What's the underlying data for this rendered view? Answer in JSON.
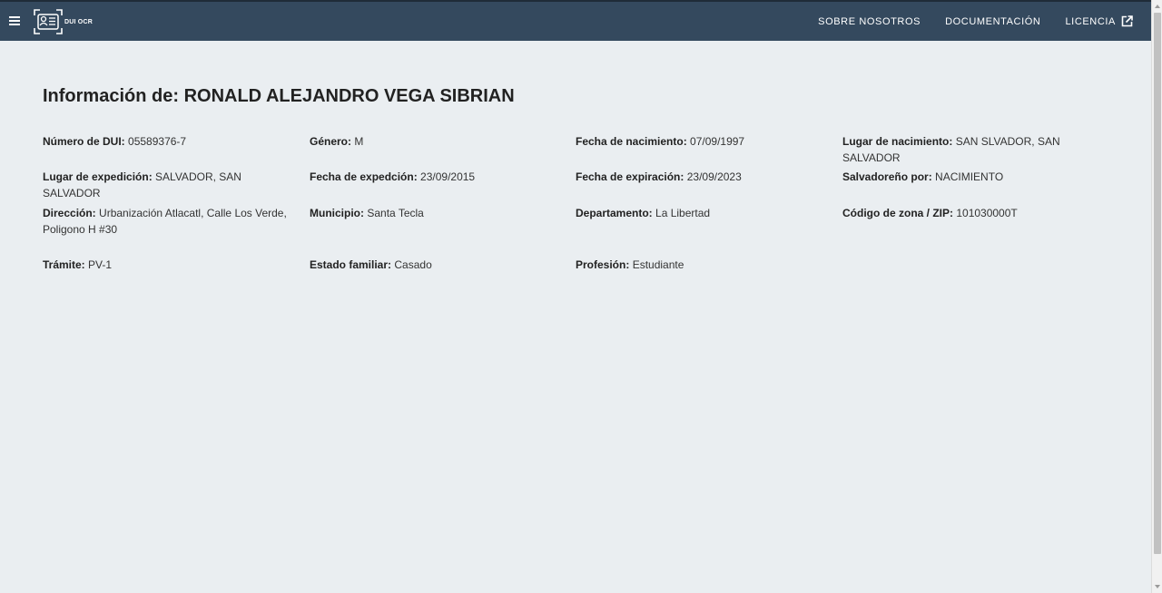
{
  "header": {
    "logo_text": "DUI OCR",
    "nav": [
      {
        "label": "SOBRE NOSOTROS"
      },
      {
        "label": "DOCUMENTACIÓN"
      },
      {
        "label": "LICENCIA"
      }
    ]
  },
  "page": {
    "title_prefix": "Información de:",
    "title_name": "RONALD ALEJANDRO VEGA SIBRIAN"
  },
  "fields": [
    {
      "label": "Número de DUI:",
      "value": "05589376-7"
    },
    {
      "label": "Género:",
      "value": "M"
    },
    {
      "label": "Fecha de nacimiento:",
      "value": "07/09/1997"
    },
    {
      "label": "Lugar de nacimiento:",
      "value": "SAN SLVADOR, SAN SALVADOR"
    },
    {
      "label": "Lugar de expedición:",
      "value": "SALVADOR, SAN SALVADOR"
    },
    {
      "label": "Fecha de expedción:",
      "value": "23/09/2015"
    },
    {
      "label": "Fecha de expiración:",
      "value": "23/09/2023"
    },
    {
      "label": "Salvadoreño por:",
      "value": "NACIMIENTO"
    },
    {
      "label": "Dirección:",
      "value": "Urbanización Atlacatl, Calle Los Verde, Poligono H #30"
    },
    {
      "label": "Municipio:",
      "value": "Santa Tecla"
    },
    {
      "label": "Departamento:",
      "value": "La Libertad"
    },
    {
      "label": "Código de zona / ZIP:",
      "value": "101030000T"
    },
    {
      "label": "Trámite:",
      "value": "PV-1"
    },
    {
      "label": "Estado familiar:",
      "value": "Casado"
    },
    {
      "label": "Profesión:",
      "value": "Estudiante"
    }
  ],
  "colors": {
    "header_bg": "#34495e",
    "page_bg": "#eaeef1"
  }
}
